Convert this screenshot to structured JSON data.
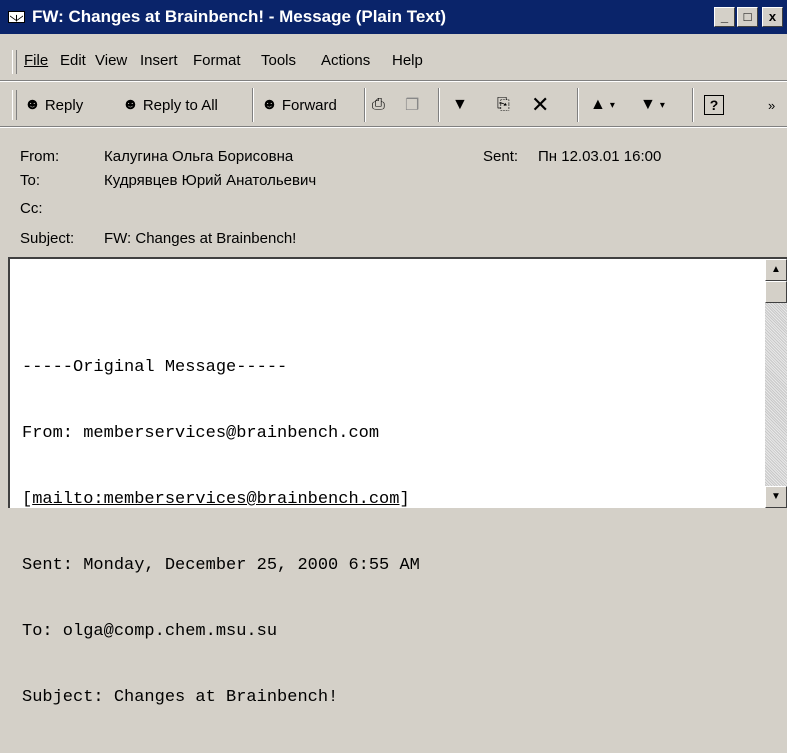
{
  "window": {
    "title": "FW: Changes at Brainbench! - Message (Plain Text)",
    "controls": {
      "minimize": "_",
      "maximize": "□",
      "close": "x"
    }
  },
  "menu": {
    "items": [
      {
        "label": "File"
      },
      {
        "label": "Edit"
      },
      {
        "label": "View"
      },
      {
        "label": "Insert"
      },
      {
        "label": "Format"
      },
      {
        "label": "Tools"
      },
      {
        "label": "Actions"
      },
      {
        "label": "Help"
      }
    ]
  },
  "toolbar": {
    "reply": "Reply",
    "reply_all": "Reply to All",
    "forward": "Forward"
  },
  "header": {
    "from_label": "From:",
    "from_value": "Калугина Ольга Борисовна",
    "sent_label": "Sent:",
    "sent_value": "Пн 12.03.01 16:00",
    "to_label": "To:",
    "to_value": "Кудрявцев Юрий Анатольевич",
    "cc_label": "Cc:",
    "cc_value": "",
    "subject_label": "Subject:",
    "subject_value": "FW: Changes at Brainbench!"
  },
  "body": {
    "lines": [
      "-----Original Message-----",
      "From: memberservices@brainbench.com",
      "[mailto:memberservices@brainbench.com]",
      "Sent: Monday, December 25, 2000 6:55 AM",
      "To: olga@comp.chem.msu.su",
      "Subject: Changes at Brainbench!"
    ]
  }
}
